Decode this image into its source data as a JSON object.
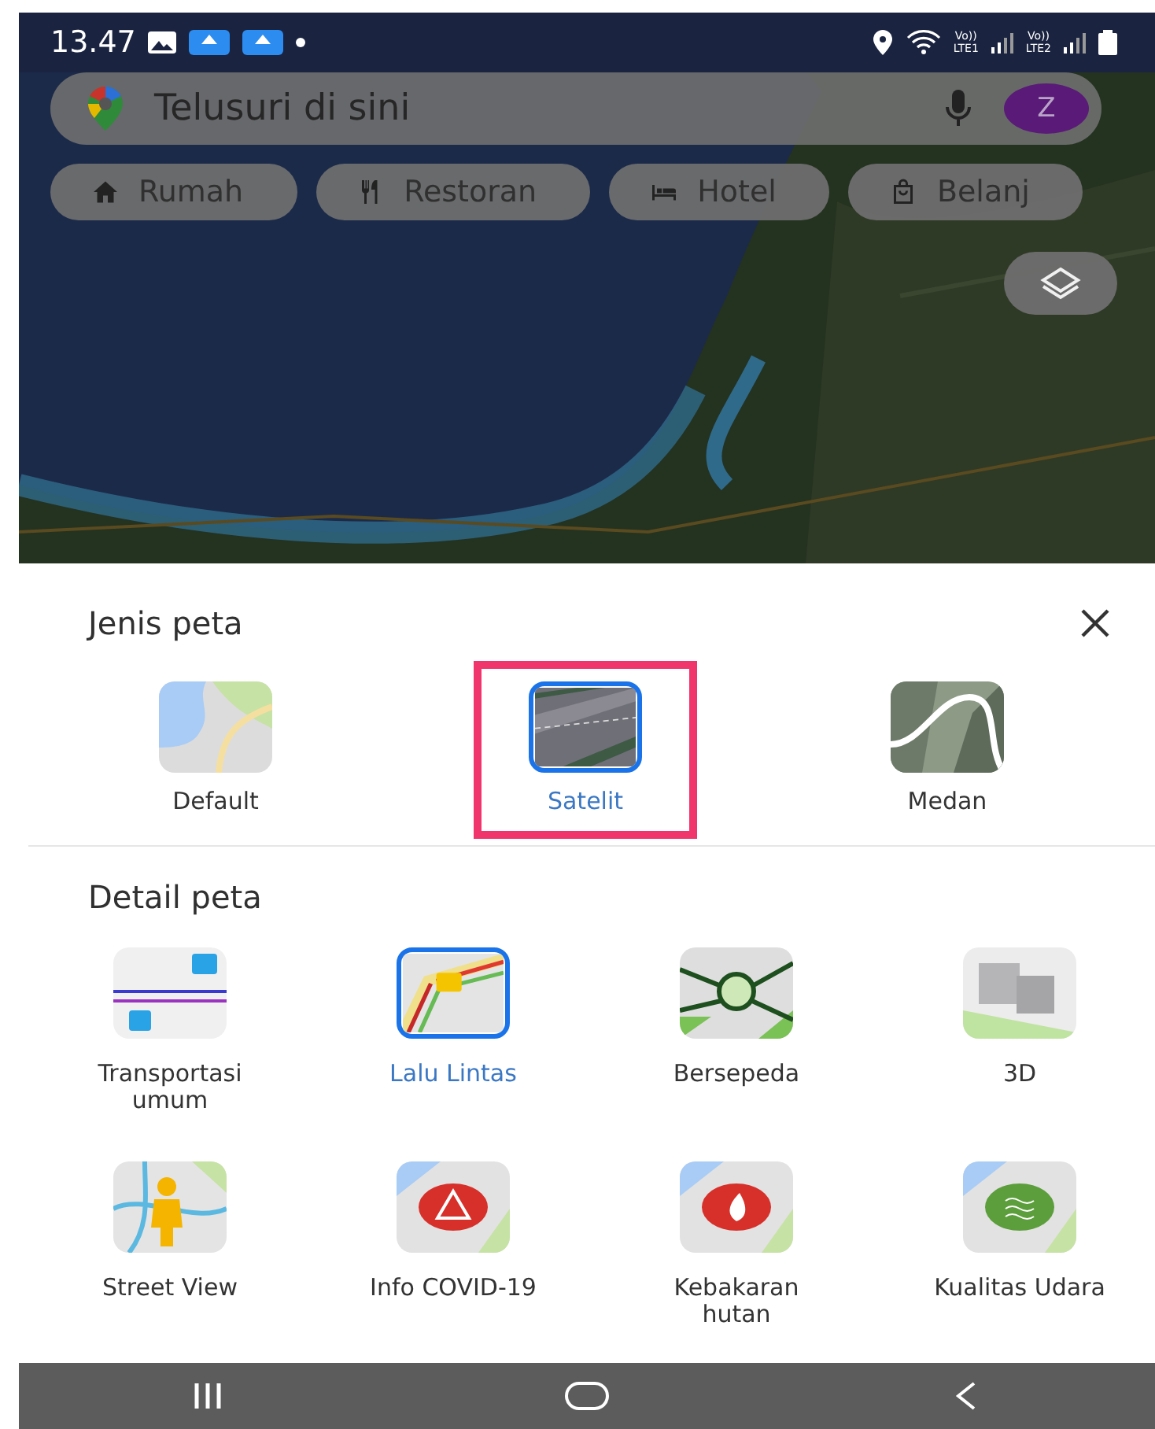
{
  "status_bar": {
    "time": "13.47",
    "network_labels": [
      {
        "top": "Vo))",
        "bottom": "LTE1"
      },
      {
        "top": "Vo))",
        "bottom": "LTE2"
      }
    ]
  },
  "search": {
    "placeholder": "Telusuri di sini",
    "avatar": "Z"
  },
  "chips": [
    {
      "kind": "home",
      "label": "Rumah"
    },
    {
      "kind": "restaurant",
      "label": "Restoran"
    },
    {
      "kind": "hotel",
      "label": "Hotel"
    },
    {
      "kind": "shopping",
      "label": "Belanj"
    }
  ],
  "map_types": {
    "title": "Jenis peta",
    "items": [
      {
        "kind": "default",
        "label": "Default",
        "selected": false,
        "highlighted": false
      },
      {
        "kind": "satellite",
        "label": "Satelit",
        "selected": true,
        "highlighted": true
      },
      {
        "kind": "terrain",
        "label": "Medan",
        "selected": false,
        "highlighted": false
      }
    ]
  },
  "map_details": {
    "title": "Detail peta",
    "items": [
      {
        "kind": "transit",
        "label": "Transportasi umum",
        "selected": false
      },
      {
        "kind": "traffic",
        "label": "Lalu Lintas",
        "selected": true
      },
      {
        "kind": "bicycle",
        "label": "Bersepeda",
        "selected": false
      },
      {
        "kind": "buildings",
        "label": "3D",
        "selected": false
      },
      {
        "kind": "streetview",
        "label": "Street View",
        "selected": false
      },
      {
        "kind": "covid",
        "label": "Info COVID-19",
        "selected": false
      },
      {
        "kind": "wildfire",
        "label": "Kebakaran hutan",
        "selected": false
      },
      {
        "kind": "airquality",
        "label": "Kualitas Udara",
        "selected": false
      }
    ]
  }
}
